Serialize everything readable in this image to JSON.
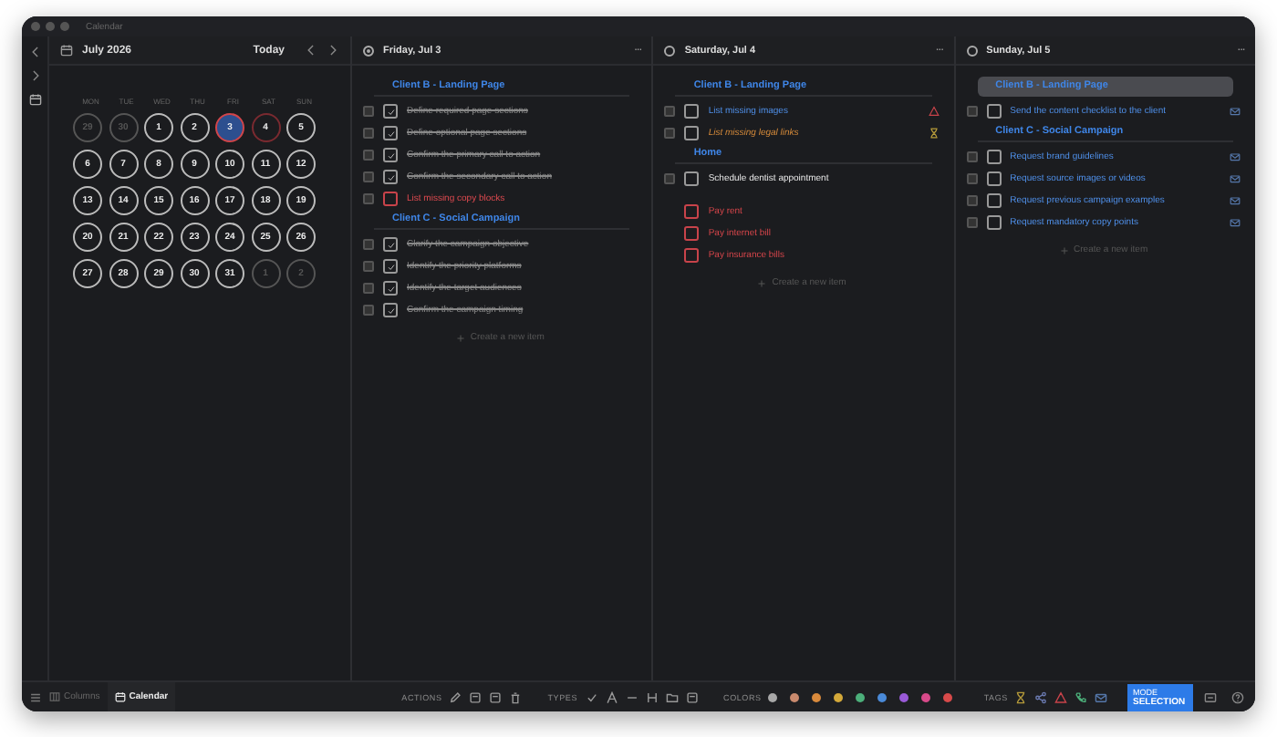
{
  "window": {
    "title": "Calendar"
  },
  "calendar": {
    "month": "July 2026",
    "today_button": "Today",
    "weekdays": [
      "MON",
      "TUE",
      "WED",
      "THU",
      "FRI",
      "SAT",
      "SUN"
    ],
    "days": [
      {
        "label": "29",
        "kind": "other",
        "selected": false,
        "flagged": false
      },
      {
        "label": "30",
        "kind": "other",
        "selected": false,
        "flagged": false
      },
      {
        "label": "1",
        "kind": "current",
        "selected": false,
        "flagged": false
      },
      {
        "label": "2",
        "kind": "current",
        "selected": false,
        "flagged": false
      },
      {
        "label": "3",
        "kind": "current",
        "selected": true,
        "flagged": true
      },
      {
        "label": "4",
        "kind": "current",
        "selected": false,
        "flagged": true
      },
      {
        "label": "5",
        "kind": "current",
        "selected": false,
        "flagged": false
      },
      {
        "label": "6",
        "kind": "current",
        "selected": false,
        "flagged": false
      },
      {
        "label": "7",
        "kind": "current",
        "selected": false,
        "flagged": false
      },
      {
        "label": "8",
        "kind": "current",
        "selected": false,
        "flagged": false
      },
      {
        "label": "9",
        "kind": "current",
        "selected": false,
        "flagged": false
      },
      {
        "label": "10",
        "kind": "current",
        "selected": false,
        "flagged": false
      },
      {
        "label": "11",
        "kind": "current",
        "selected": false,
        "flagged": false
      },
      {
        "label": "12",
        "kind": "current",
        "selected": false,
        "flagged": false
      },
      {
        "label": "13",
        "kind": "current",
        "selected": false,
        "flagged": false
      },
      {
        "label": "14",
        "kind": "current",
        "selected": false,
        "flagged": false
      },
      {
        "label": "15",
        "kind": "current",
        "selected": false,
        "flagged": false
      },
      {
        "label": "16",
        "kind": "current",
        "selected": false,
        "flagged": false
      },
      {
        "label": "17",
        "kind": "current",
        "selected": false,
        "flagged": false
      },
      {
        "label": "18",
        "kind": "current",
        "selected": false,
        "flagged": false
      },
      {
        "label": "19",
        "kind": "current",
        "selected": false,
        "flagged": false
      },
      {
        "label": "20",
        "kind": "current",
        "selected": false,
        "flagged": false
      },
      {
        "label": "21",
        "kind": "current",
        "selected": false,
        "flagged": false
      },
      {
        "label": "22",
        "kind": "current",
        "selected": false,
        "flagged": false
      },
      {
        "label": "23",
        "kind": "current",
        "selected": false,
        "flagged": false
      },
      {
        "label": "24",
        "kind": "current",
        "selected": false,
        "flagged": false
      },
      {
        "label": "25",
        "kind": "current",
        "selected": false,
        "flagged": false
      },
      {
        "label": "26",
        "kind": "current",
        "selected": false,
        "flagged": false
      },
      {
        "label": "27",
        "kind": "current",
        "selected": false,
        "flagged": false
      },
      {
        "label": "28",
        "kind": "current",
        "selected": false,
        "flagged": false
      },
      {
        "label": "29",
        "kind": "current",
        "selected": false,
        "flagged": false
      },
      {
        "label": "30",
        "kind": "current",
        "selected": false,
        "flagged": false
      },
      {
        "label": "31",
        "kind": "current",
        "selected": false,
        "flagged": false
      },
      {
        "label": "1",
        "kind": "other",
        "selected": false,
        "flagged": false
      },
      {
        "label": "2",
        "kind": "other",
        "selected": false,
        "flagged": false
      }
    ]
  },
  "days": [
    {
      "title": "Friday, Jul 3",
      "selected": true,
      "menu": "···",
      "create_label": "Create a new item",
      "groups": [
        {
          "heading": "Client B - Landing Page",
          "selected": false,
          "items": [
            {
              "text": "Define required page sections",
              "kind": "task",
              "checked": true
            },
            {
              "text": "Define optional page sections",
              "kind": "task",
              "checked": true
            },
            {
              "text": "Confirm the primary call to action",
              "kind": "task",
              "checked": true
            },
            {
              "text": "Confirm the secondary call to action",
              "kind": "task",
              "checked": true
            },
            {
              "text": "List missing copy blocks",
              "kind": "overdue",
              "checked": false
            }
          ]
        },
        {
          "heading": "Client C - Social Campaign",
          "selected": false,
          "items": [
            {
              "text": "Clarify the campaign objective",
              "kind": "task",
              "checked": true
            },
            {
              "text": "Identify the priority platforms",
              "kind": "task",
              "checked": true
            },
            {
              "text": "Identify the target audiences",
              "kind": "task",
              "checked": true
            },
            {
              "text": "Confirm the campaign timing",
              "kind": "task",
              "checked": true
            }
          ]
        }
      ]
    },
    {
      "title": "Saturday, Jul 4",
      "selected": false,
      "menu": "···",
      "create_label": "Create a new item",
      "groups": [
        {
          "heading": "Client B - Landing Page",
          "selected": false,
          "items": [
            {
              "text": "List missing images",
              "kind": "alert",
              "checked": false
            },
            {
              "text": "List missing legal links",
              "kind": "waiting",
              "checked": false
            }
          ]
        },
        {
          "heading": "Home",
          "selected": false,
          "items": [
            {
              "text": "Schedule dentist appointment",
              "kind": "personal",
              "checked": false
            }
          ]
        },
        {
          "items": [
            {
              "text": "Pay rent",
              "kind": "bill",
              "checked": false
            },
            {
              "text": "Pay internet bill",
              "kind": "bill",
              "checked": false
            },
            {
              "text": "Pay insurance bills",
              "kind": "bill",
              "checked": false
            }
          ]
        }
      ]
    },
    {
      "title": "Sunday, Jul 5",
      "selected": false,
      "menu": "···",
      "create_label": "Create a new item",
      "groups": [
        {
          "heading": "Client B - Landing Page",
          "selected": true,
          "items": [
            {
              "text": "Send the content checklist to the client",
              "kind": "email",
              "checked": false
            }
          ]
        },
        {
          "heading": "Client C - Social Campaign",
          "selected": false,
          "items": [
            {
              "text": "Request brand guidelines",
              "kind": "email",
              "checked": false
            },
            {
              "text": "Request source images or videos",
              "kind": "email",
              "checked": false
            },
            {
              "text": "Request previous campaign examples",
              "kind": "email",
              "checked": false
            },
            {
              "text": "Request mandatory copy points",
              "kind": "email",
              "checked": false
            }
          ]
        }
      ]
    }
  ],
  "bottom_bar": {
    "views": [
      {
        "label": "Columns",
        "selected": false
      },
      {
        "label": "Calendar",
        "selected": true
      }
    ],
    "actions_label": "ACTIONS",
    "types_label": "TYPES",
    "colors_label": "COLORS",
    "tags_label": "TAGS",
    "colors": [
      {
        "color": "#a8a8a8"
      },
      {
        "color": "#c98a6e"
      },
      {
        "color": "#d98a3c"
      },
      {
        "color": "#d4a93a"
      },
      {
        "color": "#4caf7a"
      },
      {
        "color": "#4a8ad8"
      },
      {
        "color": "#9a5ad8"
      },
      {
        "color": "#d84a8a"
      },
      {
        "color": "#d84a4a"
      }
    ],
    "mode": {
      "caption": "MODE",
      "label": "SELECTION"
    }
  }
}
